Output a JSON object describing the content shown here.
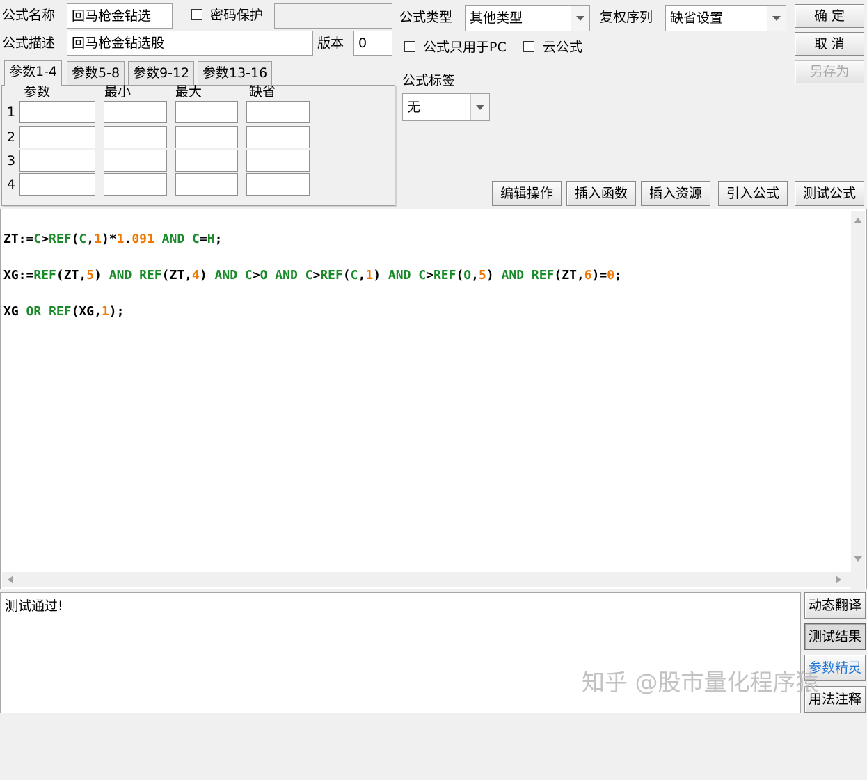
{
  "formula_name": {
    "label": "公式名称",
    "value": "回马枪金钻选"
  },
  "password": {
    "label": "密码保护",
    "value": ""
  },
  "formula_type": {
    "label": "公式类型",
    "value": "其他类型"
  },
  "adjust_seq": {
    "label": "复权序列",
    "value": "缺省设置"
  },
  "formula_desc": {
    "label": "公式描述",
    "value": "回马枪金钻选股"
  },
  "version": {
    "label": "版本",
    "value": "0"
  },
  "pc_only_label": "公式只用于PC",
  "cloud_label": "云公式",
  "formula_tag": {
    "label": "公式标签",
    "value": "无"
  },
  "buttons": {
    "ok": "确 定",
    "cancel": "取 消",
    "save_as": "另存为",
    "edit_ops": "编辑操作",
    "insert_func": "插入函数",
    "insert_res": "插入资源",
    "import": "引入公式",
    "test": "测试公式",
    "dynamic_translate": "动态翻译",
    "test_result": "测试结果",
    "param_wizard": "参数精灵",
    "usage_notes": "用法注释"
  },
  "tabs": [
    "参数1-4",
    "参数5-8",
    "参数9-12",
    "参数13-16"
  ],
  "params": {
    "headers": [
      "参数",
      "最小",
      "最大",
      "缺省"
    ],
    "rows": [
      "1",
      "2",
      "3",
      "4"
    ]
  },
  "code_lines": [
    "ZT:=C>REF(C,1)*1.091 AND C=H;",
    "XG:=REF(ZT,5) AND REF(ZT,4) AND C>O AND C>REF(C,1) AND C>REF(O,5) AND REF(ZT,6)=0;",
    "XG OR REF(XG,1);"
  ],
  "output_text": "测试通过!",
  "watermark": "知乎 @股市量化程序猿"
}
